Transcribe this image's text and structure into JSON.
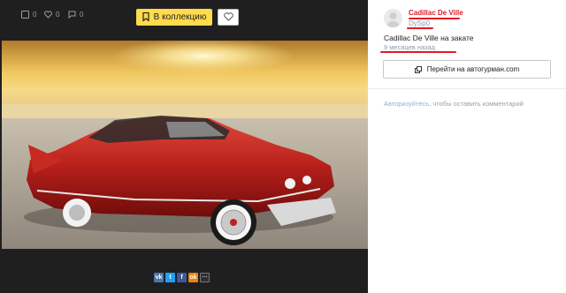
{
  "toolbar": {
    "collect_label": "В коллекцию",
    "collect_icon": "bookmark-icon",
    "like_icon": "heart-icon"
  },
  "photo": {
    "description_icon": "photo-image"
  },
  "stats": {
    "photos": "0",
    "likes": "0",
    "comments": "0"
  },
  "share": {
    "vk": "vk",
    "twitter": "t",
    "facebook": "f",
    "odnoklassniki": "ok",
    "more": "···"
  },
  "panel": {
    "car_name": "Cadillac De Ville",
    "user_name": "DySp0",
    "caption": "Cadillac De Ville на закате",
    "time_ago": "9 месяцев назад",
    "goto_label": "Перейти на автогурман.com",
    "comment_link": "Авторизуйтесь",
    "comment_rest": ", чтобы оставить комментарий"
  },
  "colors": {
    "accent": "#ffdb4d",
    "brand_red": "#e31b23",
    "link": "#8fb1d9"
  }
}
